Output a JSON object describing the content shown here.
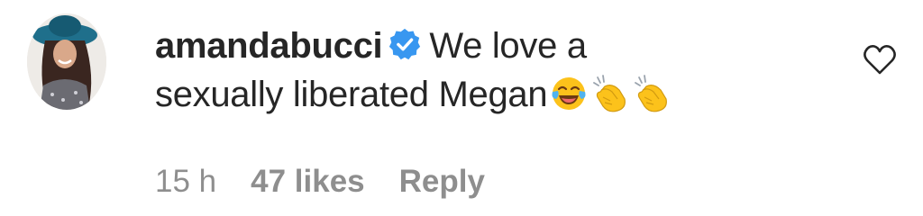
{
  "comment": {
    "username": "amandabucci",
    "verified": true,
    "text_line1": "We love a",
    "text_line2": "sexually liberated Megan",
    "emojis": [
      "face-with-tears-of-joy-emoji",
      "clapping-hands-emoji",
      "clapping-hands-emoji"
    ],
    "time": "15 h",
    "likes": "47 likes",
    "reply_label": "Reply"
  },
  "colors": {
    "text": "#262626",
    "muted": "#8e8e8e",
    "verified_blue": "#3897f0",
    "emoji_yellow": "#fcc21b"
  }
}
